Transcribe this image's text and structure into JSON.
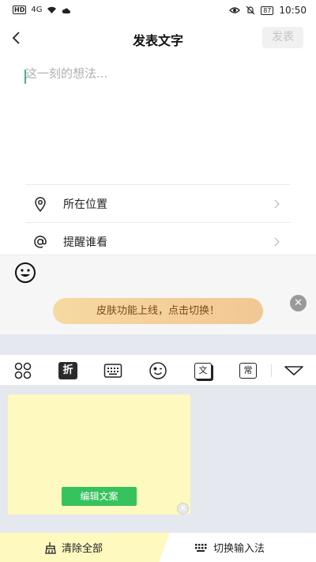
{
  "status_bar": {
    "hd_badge": "HD",
    "signal": "4G",
    "battery": "87",
    "time": "10:50"
  },
  "nav": {
    "title": "发表文字",
    "publish_label": "发表"
  },
  "composer": {
    "placeholder": "这一刻的想法..."
  },
  "options": [
    {
      "label": "所在位置",
      "icon": "location-pin-icon"
    },
    {
      "label": "提醒谁看",
      "icon": "at-sign-icon"
    }
  ],
  "emoji_bar": {
    "icon": "smiley-icon"
  },
  "banner": {
    "text": "皮肤功能上线，点击切换！",
    "close_icon": "close-icon"
  },
  "keyboard": {
    "toolbar": [
      "apps-grid-icon",
      "clipboard-crop-icon",
      "keyboard-icon",
      "wink-emoji-icon",
      "text-translate-icon",
      "common-phrases-icon",
      "collapse-keyboard-icon"
    ],
    "clipboard_tool_label": "折",
    "translate_tool_label": "文",
    "phrases_tool_label": "常",
    "card": {
      "edit_button": "编辑文案"
    }
  },
  "bottom_bar": {
    "clear_all": "清除全部",
    "switch_ime": "切换输入法"
  },
  "colors": {
    "accent_green": "#36c25c",
    "caret": "#27c27c",
    "banner_gradient_start": "#f7d9a2",
    "banner_text": "#7a4a1e",
    "keyboard_bg": "#e6e8f0",
    "note_card": "#fdf9bf"
  }
}
